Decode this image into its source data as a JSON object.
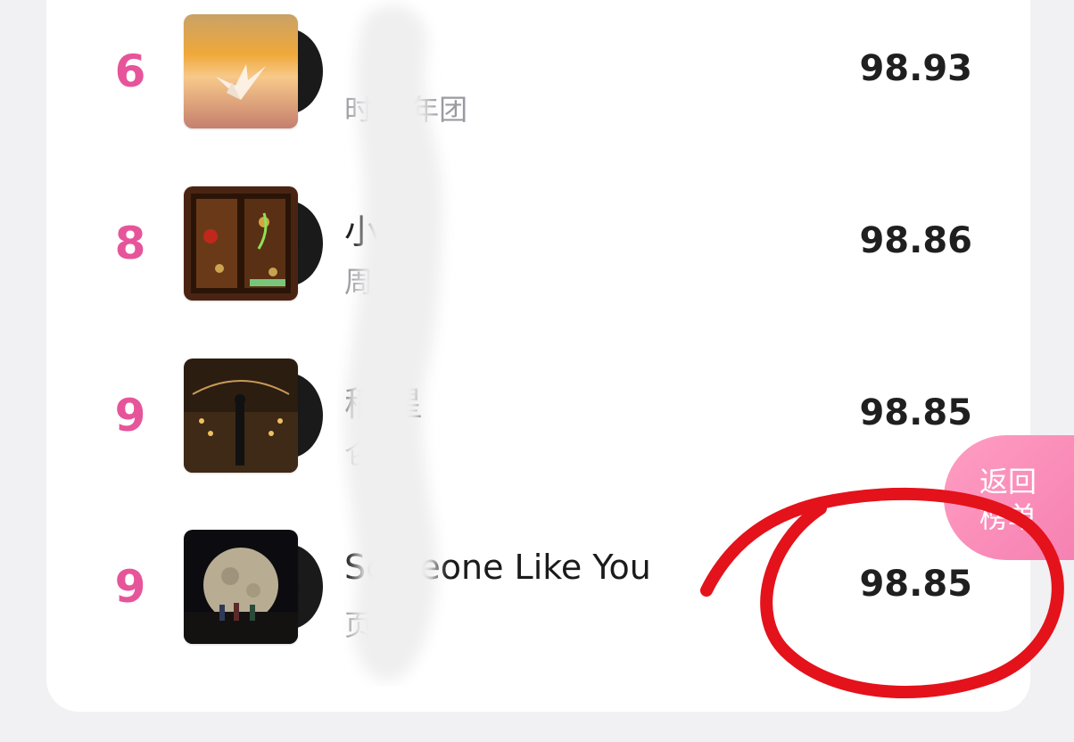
{
  "rows": [
    {
      "rank": "6",
      "title": "",
      "artist": "时  少年团",
      "score": "98.93",
      "cover": "crane"
    },
    {
      "rank": "8",
      "title": "小        雨",
      "artist": "周",
      "score": "98.86",
      "cover": "window"
    },
    {
      "rank": "9",
      "title": "稻       星",
      "artist": "     仑",
      "score": "98.85",
      "cover": "church"
    },
    {
      "rank": "9",
      "title": "Someone Like You",
      "artist": "     页",
      "score": "98.85",
      "cover": "moon"
    }
  ],
  "return_button": {
    "line1": "返回",
    "line2": "榜单"
  },
  "colors": {
    "rank": "#e6559a",
    "accent_pink": "#f57fb1",
    "annotation_red": "#e4121b"
  }
}
